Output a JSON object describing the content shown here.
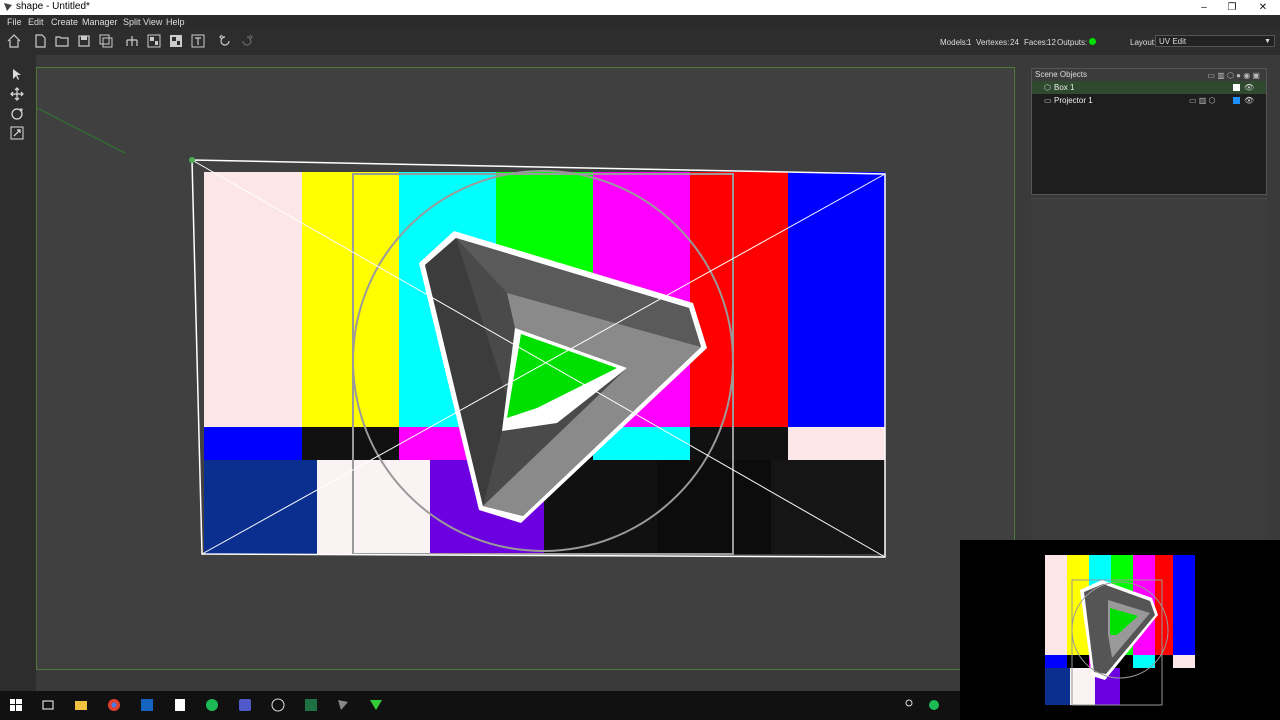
{
  "window": {
    "title": "shape - Untitled*",
    "buttons": [
      "–",
      "❐",
      "✕"
    ]
  },
  "menu": [
    "File",
    "Edit",
    "Create",
    "Manager",
    "Split View",
    "Help"
  ],
  "toolbar_icons": [
    "home-icon",
    "new-file-icon",
    "open-folder-icon",
    "save-icon",
    "save-as-icon",
    "hierarchy-icon",
    "group-icon",
    "ungroup-icon",
    "transform-icon",
    "undo-icon",
    "redo-icon"
  ],
  "stats": {
    "models_label": "Models:",
    "models": "1",
    "vertexes_label": "Vertexes:",
    "vertexes": "24",
    "faces_label": "Faces:",
    "faces": "12",
    "outputs_label": "Outputs:"
  },
  "layout": {
    "label": "Layout:",
    "value": "UV Edit"
  },
  "left_tools": [
    "select-arrow-icon",
    "move-icon",
    "rotate-icon",
    "scale-icon"
  ],
  "scene": {
    "header": "Scene Objects",
    "items": [
      {
        "label": "Box 1",
        "selected": true,
        "swatch": "#ffffff"
      },
      {
        "label": "Projector 1",
        "selected": false,
        "swatch": "#1f8fff"
      }
    ]
  },
  "taskbar_icons": [
    "windows-start-icon",
    "task-view-icon",
    "file-explorer-icon",
    "chrome-icon",
    "outlook-icon",
    "notes-icon",
    "spotify-icon",
    "teams-icon",
    "obs-icon",
    "excel-icon",
    "shape-app-icon",
    "vector-app-icon"
  ],
  "colors": {
    "accent_green": "#00e000",
    "viewport_border": "#4d7a3a",
    "panel_bg": "#2d2d2d"
  },
  "test_pattern": {
    "bars": [
      "#fde6e8",
      "#ffff00",
      "#00ffff",
      "#00ff00",
      "#ff00ff",
      "#ff0000",
      "#0000ff"
    ],
    "mid_row": [
      "#0000ff",
      "#111111",
      "#ff00ff",
      "#111111",
      "#00ffff",
      "#111111",
      "#fde6e8"
    ],
    "bottom_row": [
      "#0a2f8f",
      "#fbf3f3",
      "#6c00e0",
      "#111111",
      "#0c0c0c",
      "#151515"
    ]
  }
}
